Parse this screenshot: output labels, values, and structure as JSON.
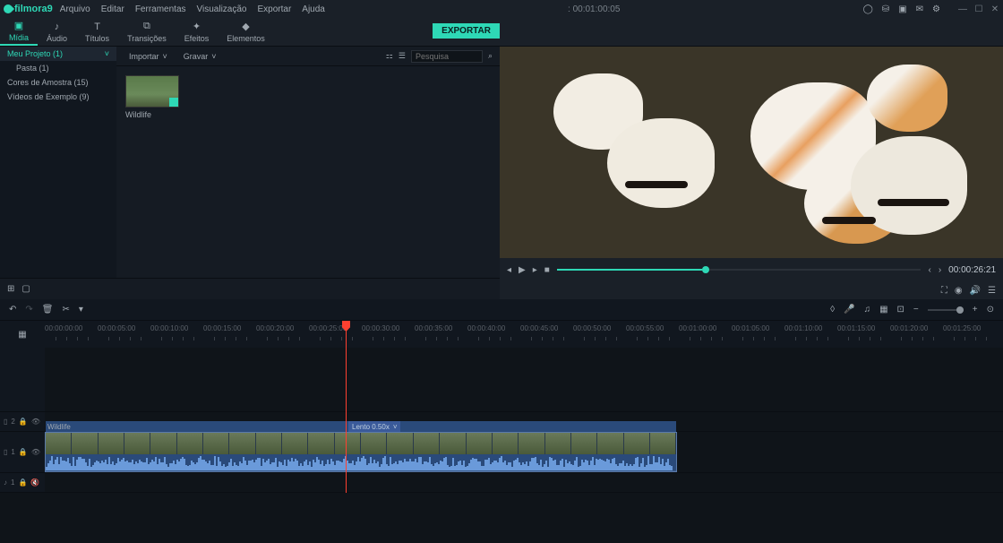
{
  "app": {
    "name": "filmora9"
  },
  "menu": {
    "items": [
      "Arquivo",
      "Editar",
      "Ferramentas",
      "Visualização",
      "Exportar",
      "Ajuda"
    ]
  },
  "titlebar": {
    "timestamp": ": 00:01:00:05"
  },
  "tabs": {
    "items": [
      {
        "label": "Mídia",
        "icon": "folder"
      },
      {
        "label": "Áudio",
        "icon": "music"
      },
      {
        "label": "Títulos",
        "icon": "text"
      },
      {
        "label": "Transições",
        "icon": "transition"
      },
      {
        "label": "Efeitos",
        "icon": "fx"
      },
      {
        "label": "Elementos",
        "icon": "shapes"
      }
    ],
    "export_label": "EXPORTAR"
  },
  "sidebar": {
    "items": [
      {
        "label": "Meu Projeto (1)",
        "selected": true
      },
      {
        "label": "Pasta (1)",
        "indent": true
      },
      {
        "label": "Cores de Amostra (15)"
      },
      {
        "label": "Vídeos de Exemplo (9)"
      }
    ]
  },
  "media_toolbar": {
    "import_label": "Importar",
    "record_label": "Gravar",
    "search_placeholder": "Pesquisa"
  },
  "media": {
    "items": [
      {
        "name": "Wildlife"
      }
    ]
  },
  "preview": {
    "progress_pct": 40,
    "duration": "00:00:26:21"
  },
  "timeline": {
    "ruler_ticks": [
      "00:00:00:00",
      "00:00:05:00",
      "00:00:10:00",
      "00:00:15:00",
      "00:00:20:00",
      "00:00:25:00",
      "00:00:30:00",
      "00:00:35:00",
      "00:00:40:00",
      "00:00:45:00",
      "00:00:50:00",
      "00:00:55:00",
      "00:01:00:00",
      "00:01:05:00",
      "00:01:10:00",
      "00:01:15:00",
      "00:01:20:00",
      "00:01:25:00"
    ],
    "playhead_pct": 30,
    "tracks": {
      "t2": "2",
      "t1": "1",
      "a1": "1"
    },
    "clip": {
      "title": "Wildlife",
      "speed_label": "Lento 0.50x",
      "speed_start_pct": 48,
      "width_pct": 66
    }
  }
}
